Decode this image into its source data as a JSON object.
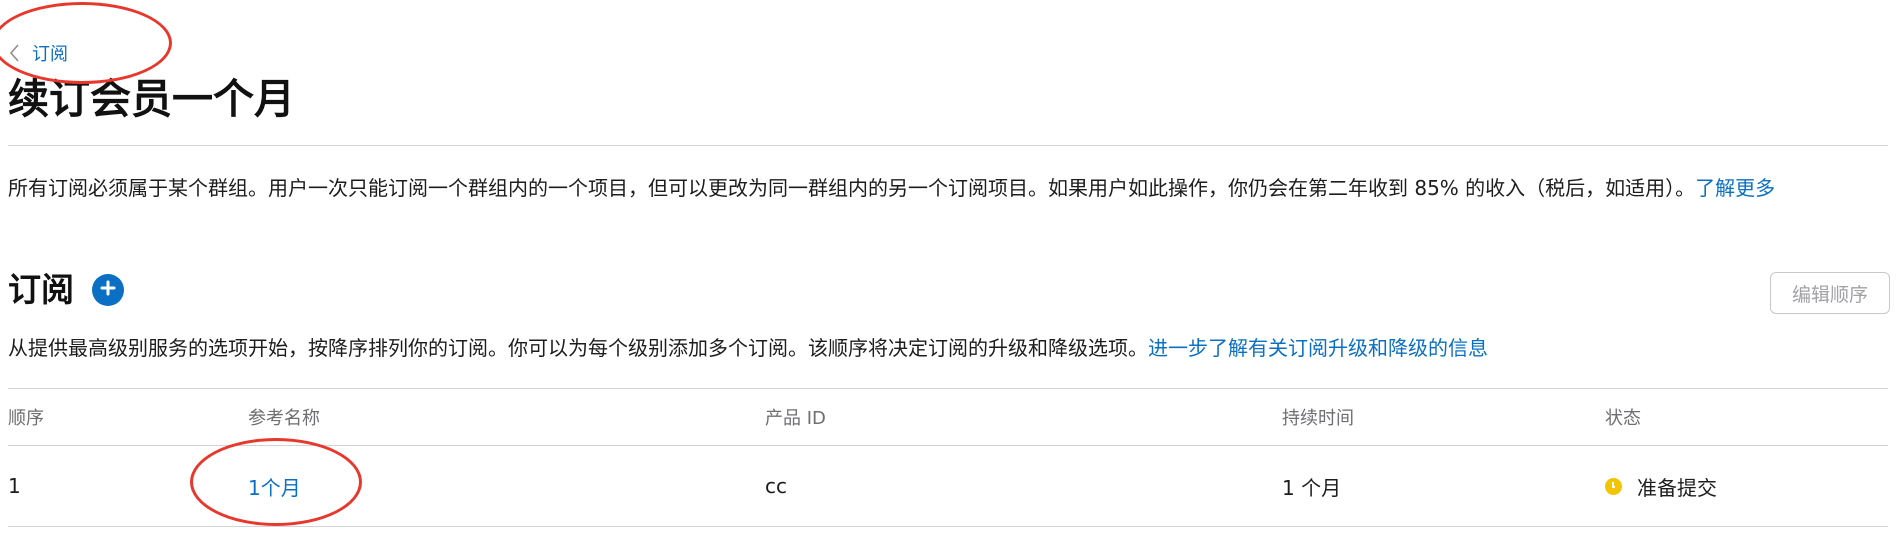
{
  "breadcrumb": {
    "back_label": "订阅"
  },
  "page": {
    "title": "续订会员一个月"
  },
  "group_info": {
    "description": "所有订阅必须属于某个群组。用户一次只能订阅一个群组内的一个项目，但可以更改为同一群组内的另一个订阅项目。如果用户如此操作，你仍会在第二年收到 85% 的收入（税后，如适用）。",
    "learn_more": "了解更多"
  },
  "subscriptions_section": {
    "title": "订阅",
    "edit_order_label": "编辑顺序",
    "description": "从提供最高级别服务的选项开始，按降序排列你的订阅。你可以为每个级别添加多个订阅。该顺序将决定订阅的升级和降级选项。",
    "learn_more_link": "进一步了解有关订阅升级和降级的信息"
  },
  "table": {
    "columns": [
      "顺序",
      "参考名称",
      "产品 ID",
      "持续时间",
      "状态"
    ],
    "rows": [
      {
        "order": "1",
        "reference_name": "1个月",
        "product_id": "cc",
        "duration": "1 个月",
        "status": "准备提交"
      }
    ]
  },
  "colors": {
    "link": "#0b6fc3",
    "status_ready": "#f5c400",
    "annotation": "#e8372c"
  },
  "icons": {
    "back": "chevron-left-icon",
    "add": "plus-circle-icon",
    "status": "clock-status-icon"
  }
}
